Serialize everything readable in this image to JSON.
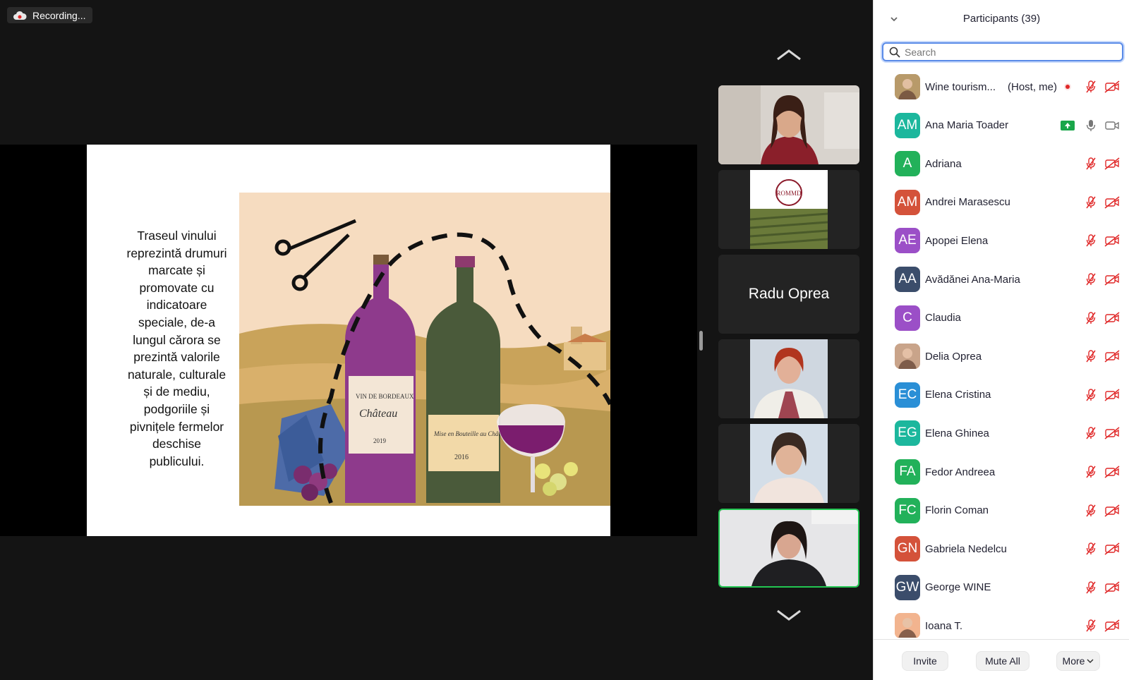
{
  "recording": {
    "label": "Recording..."
  },
  "slide": {
    "text_lines": [
      "Traseul vinului",
      "reprezintă drumuri",
      "marcate și",
      "promovate cu",
      "indicatoare",
      "speciale, de-a",
      "lungul cărora se",
      "prezintă valorile",
      "naturale, culturale",
      "și de mediu,",
      "podgoriile și",
      "pivnițele fermelor",
      "deschise",
      "publicului."
    ],
    "bottle_label_left": [
      "VIN DE BORDEAUX",
      "Château",
      "2019"
    ],
    "bottle_label_right": [
      "Mise en Bouteille au Château",
      "2016"
    ]
  },
  "gallery": {
    "tiles": [
      {
        "kind": "video",
        "person": "woman-red-top"
      },
      {
        "kind": "logo",
        "logo_text": "ROMMD"
      },
      {
        "kind": "name",
        "name": "Radu Oprea"
      },
      {
        "kind": "video",
        "person": "woman-red-hair"
      },
      {
        "kind": "video",
        "person": "woman-dark-hair"
      },
      {
        "kind": "video",
        "person": "woman-glasses",
        "active": true
      }
    ]
  },
  "panel": {
    "title": "Participants (39)",
    "search_placeholder": "Search",
    "participants": [
      {
        "initials": "",
        "name": "Wine tourism...",
        "tag": "(Host, me)",
        "avatar_color": "#b89a6a",
        "photo": true,
        "recording": true,
        "mic": "muted",
        "cam": "off"
      },
      {
        "initials": "AM",
        "name": "Ana Maria Toader",
        "tag": "",
        "avatar_color": "#1cb79d",
        "sharing": true,
        "mic": "on",
        "cam": "on"
      },
      {
        "initials": "A",
        "name": "Adriana",
        "tag": "",
        "avatar_color": "#22b15a",
        "mic": "muted",
        "cam": "off"
      },
      {
        "initials": "AM",
        "name": "Andrei Marasescu",
        "tag": "",
        "avatar_color": "#d4523a",
        "mic": "muted",
        "cam": "off"
      },
      {
        "initials": "AE",
        "name": "Apopei Elena",
        "tag": "",
        "avatar_color": "#9b4fc7",
        "mic": "muted",
        "cam": "off"
      },
      {
        "initials": "AA",
        "name": "Avădănei Ana-Maria",
        "tag": "",
        "avatar_color": "#3b4d6b",
        "mic": "muted",
        "cam": "off"
      },
      {
        "initials": "C",
        "name": "Claudia",
        "tag": "",
        "avatar_color": "#9b4fc7",
        "mic": "muted",
        "cam": "off"
      },
      {
        "initials": "",
        "name": "Delia Oprea",
        "tag": "",
        "avatar_color": "#c9a48a",
        "photo": true,
        "mic": "muted",
        "cam": "off"
      },
      {
        "initials": "EC",
        "name": "Elena Cristina",
        "tag": "",
        "avatar_color": "#2a8fd6",
        "mic": "muted",
        "cam": "off"
      },
      {
        "initials": "EG",
        "name": "Elena Ghinea",
        "tag": "",
        "avatar_color": "#1cb79d",
        "mic": "muted",
        "cam": "off"
      },
      {
        "initials": "FA",
        "name": "Fedor Andreea",
        "tag": "",
        "avatar_color": "#22b15a",
        "mic": "muted",
        "cam": "off"
      },
      {
        "initials": "FC",
        "name": "Florin Coman",
        "tag": "",
        "avatar_color": "#22b15a",
        "mic": "muted",
        "cam": "off"
      },
      {
        "initials": "GN",
        "name": "Gabriela Nedelcu",
        "tag": "",
        "avatar_color": "#d4523a",
        "mic": "muted",
        "cam": "off"
      },
      {
        "initials": "GW",
        "name": "George WINE",
        "tag": "",
        "avatar_color": "#3b4d6b",
        "mic": "muted",
        "cam": "off"
      },
      {
        "initials": "",
        "name": "Ioana T.",
        "tag": "",
        "avatar_color": "#f2b48f",
        "photo": true,
        "mic": "muted",
        "cam": "off"
      }
    ],
    "footer": {
      "invite": "Invite",
      "mute_all": "Mute All",
      "more": "More"
    }
  }
}
